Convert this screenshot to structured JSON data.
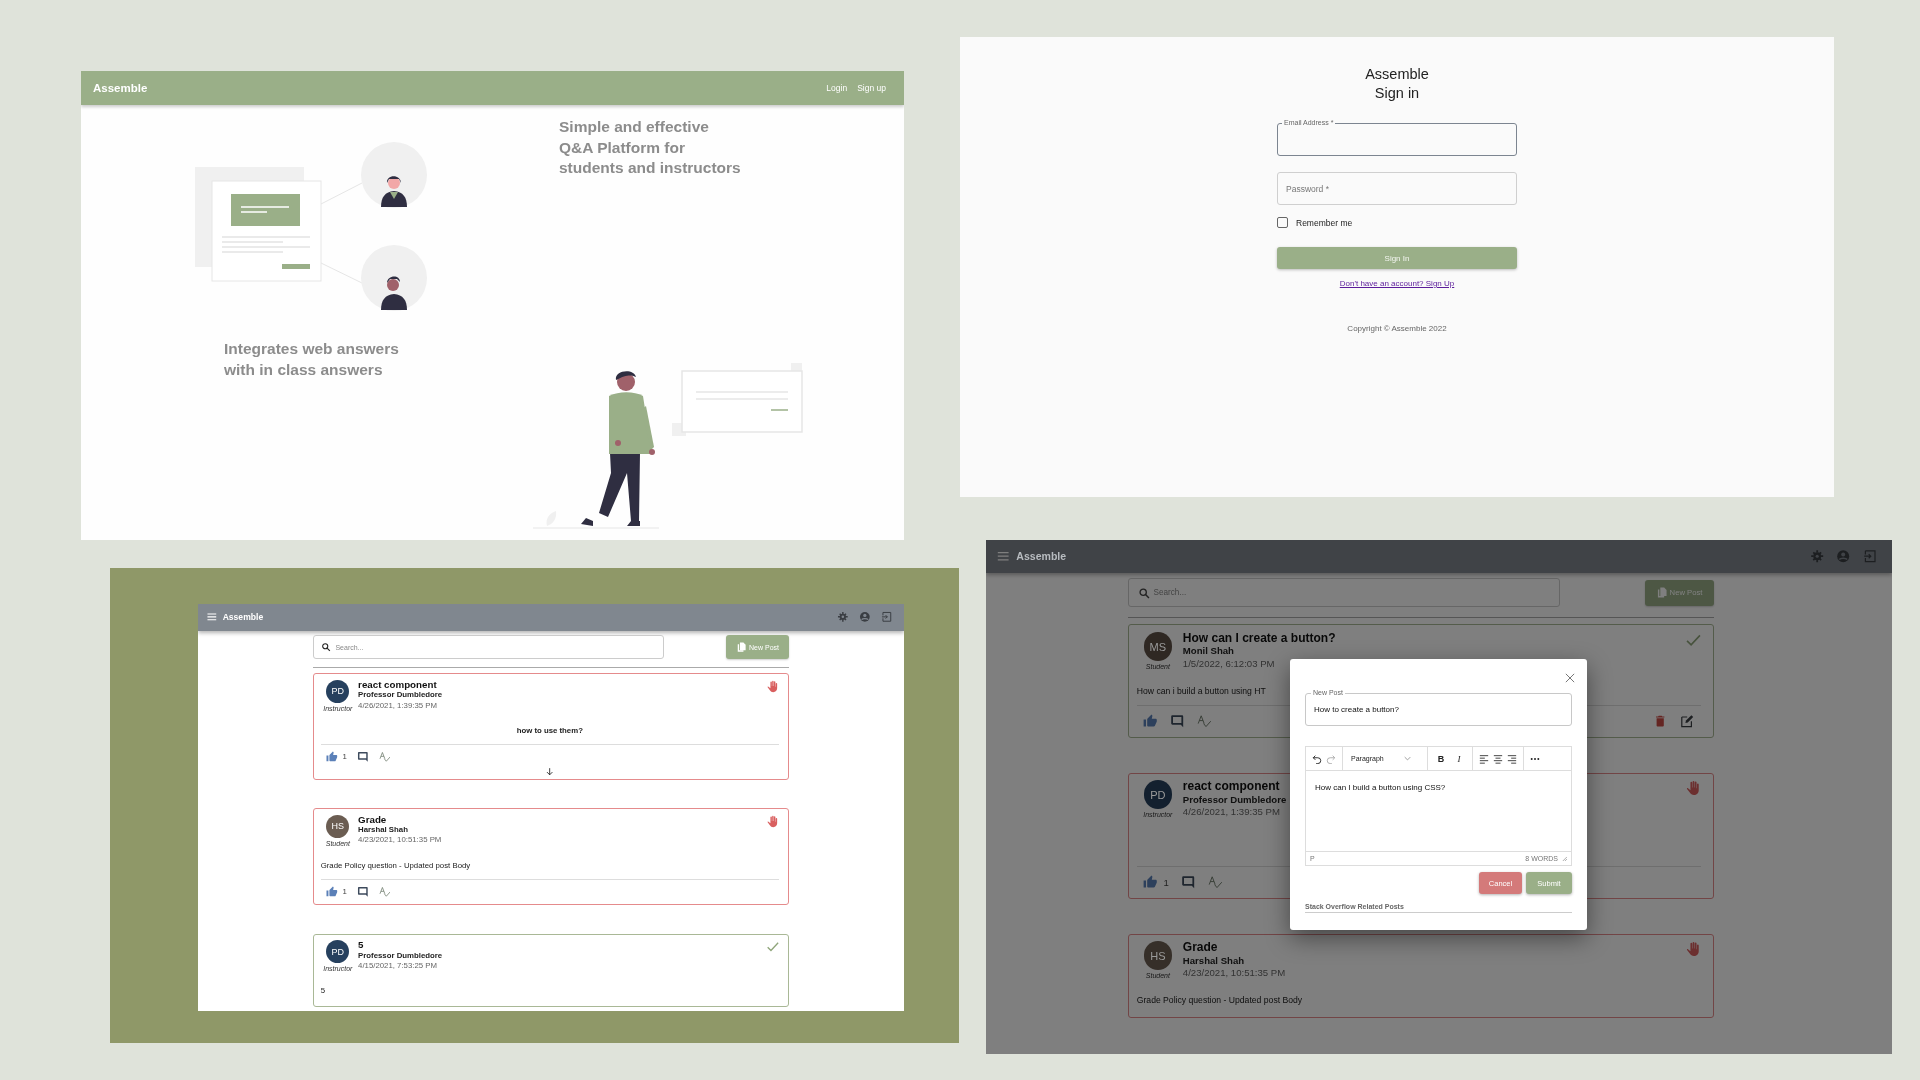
{
  "landing": {
    "brand": "Assemble",
    "nav": [
      {
        "label": "Login"
      },
      {
        "label": "Sign up"
      }
    ],
    "headline": [
      "Simple and effective",
      "Q&A Platform for",
      "students and instructors"
    ],
    "tagline": [
      "Integrates web answers",
      "with in class answers"
    ]
  },
  "signin": {
    "brand": "Assemble",
    "title": "Sign in",
    "email": {
      "label": "Email Address *",
      "focused": true
    },
    "password": {
      "placeholder": "Password *"
    },
    "remember": {
      "label": "Remember me",
      "checked": false
    },
    "submit": "Sign In",
    "link": "Don't have an account? Sign Up",
    "copyright": "Copyright © Assemble 2022"
  },
  "feed_screen": {
    "brand": "Assemble",
    "search": {
      "placeholder": "Search..."
    },
    "new_post": "New Post",
    "posts": [
      {
        "initials": "PD",
        "color": "#26405e",
        "role": "Instructor",
        "title": "react component",
        "author": "Professor Dumbledore",
        "date": "4/26/2021, 1:39:35 PM",
        "body": "how to use them?",
        "centered": true,
        "kind": "flagged",
        "likes": "1",
        "footer": true,
        "owner": false,
        "expandable": true
      },
      {
        "initials": "HS",
        "color": "#6b5d52",
        "role": "Student",
        "title": "Grade",
        "author": "Harshal Shah",
        "date": "4/23/2021, 10:51:35 PM",
        "body": "Grade Policy question - Updated post Body",
        "centered": false,
        "kind": "flagged",
        "likes": "1",
        "footer": true,
        "owner": false,
        "expandable": false
      },
      {
        "initials": "PD",
        "color": "#26405e",
        "role": "Instructor",
        "title": "5",
        "author": "Professor Dumbledore",
        "date": "4/15/2021, 7:53:25 PM",
        "body": "5",
        "centered": false,
        "kind": "resolved",
        "footer": false,
        "expandable": false
      }
    ]
  },
  "modal_screen": {
    "brand": "Assemble",
    "search": {
      "placeholder": "Search..."
    },
    "new_post": "New Post",
    "posts": [
      {
        "initials": "MS",
        "color": "#2f2823",
        "role": "Student",
        "title": "How can I create a button?",
        "author": "Monil Shah",
        "date": "1/5/2022, 6:12:03 PM",
        "body": "How can i build a button using HT",
        "centered": false,
        "kind": "resolved",
        "footer": true,
        "owner": true,
        "expandable": false
      },
      {
        "initials": "PD",
        "color": "#13202f",
        "role": "Instructor",
        "title": "react component",
        "author": "Professor Dumbledore",
        "date": "4/26/2021, 1:39:35 PM",
        "kind": "flagged",
        "likes": "1",
        "footer": true,
        "owner": false,
        "expandable": false
      },
      {
        "initials": "HS",
        "color": "#362f29",
        "role": "Student",
        "title": "Grade",
        "author": "Harshal Shah",
        "date": "4/23/2021, 10:51:35 PM",
        "body": "Grade Policy question - Updated post Body",
        "centered": false,
        "kind": "flagged",
        "footer": false,
        "expandable": false
      }
    ],
    "modal": {
      "field_label": "New Post",
      "field_value": "How to create a button?",
      "block_format": "Paragraph",
      "format_buttons": [
        "B",
        "I"
      ],
      "editor_text": "How can I build a button using CSS?",
      "path": "P",
      "word_count": "8 WORDS",
      "cancel": "Cancel",
      "submit": "Submit",
      "related_heading": "Stack Overflow Related Posts"
    }
  }
}
